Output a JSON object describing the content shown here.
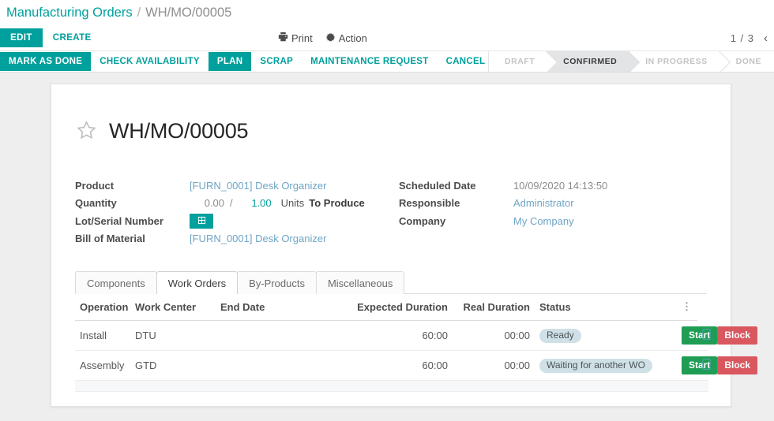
{
  "breadcrumb": {
    "root": "Manufacturing Orders",
    "separator": "/",
    "current": "WH/MO/00005"
  },
  "control_panel": {
    "edit_label": "EDIT",
    "create_label": "CREATE",
    "print_label": "Print",
    "action_label": "Action",
    "pager": "1 / 3",
    "prev_arrow": "‹"
  },
  "workflow_buttons": [
    {
      "label": "MARK AS DONE",
      "primary": true
    },
    {
      "label": "CHECK AVAILABILITY",
      "primary": false
    },
    {
      "label": "PLAN",
      "primary": true
    },
    {
      "label": "SCRAP",
      "primary": false
    },
    {
      "label": "MAINTENANCE REQUEST",
      "primary": false
    },
    {
      "label": "CANCEL",
      "primary": false
    }
  ],
  "statusbar": [
    {
      "label": "DRAFT",
      "active": false
    },
    {
      "label": "CONFIRMED",
      "active": true
    },
    {
      "label": "IN PROGRESS",
      "active": false
    },
    {
      "label": "DONE",
      "active": false
    }
  ],
  "record": {
    "title": "WH/MO/00005",
    "left_fields": {
      "product_label": "Product",
      "product_value": "[FURN_0001] Desk Organizer",
      "quantity_label": "Quantity",
      "quantity_done": "0.00",
      "quantity_slash": "/",
      "quantity_todo": "1.00",
      "quantity_uom": "Units",
      "quantity_suffix": "To Produce",
      "lot_label": "Lot/Serial Number",
      "bom_label": "Bill of Material",
      "bom_value": "[FURN_0001] Desk Organizer"
    },
    "right_fields": {
      "scheduled_label": "Scheduled Date",
      "scheduled_value": "10/09/2020 14:13:50",
      "responsible_label": "Responsible",
      "responsible_value": "Administrator",
      "company_label": "Company",
      "company_value": "My Company"
    }
  },
  "notebook": {
    "tabs": [
      {
        "label": "Components",
        "active": false
      },
      {
        "label": "Work Orders",
        "active": true
      },
      {
        "label": "By-Products",
        "active": false
      },
      {
        "label": "Miscellaneous",
        "active": false
      }
    ]
  },
  "work_orders_table": {
    "columns": [
      "Operation",
      "Work Center",
      "End Date",
      "Expected Duration",
      "Real Duration",
      "Status"
    ],
    "rows": [
      {
        "operation": "Install",
        "work_center": "DTU",
        "end_date": "",
        "expected_duration": "60:00",
        "real_duration": "00:00",
        "status": "Ready",
        "start_label": "Start",
        "block_label": "Block"
      },
      {
        "operation": "Assembly",
        "work_center": "GTD",
        "end_date": "",
        "expected_duration": "60:00",
        "real_duration": "00:00",
        "status": "Waiting for another WO",
        "start_label": "Start",
        "block_label": "Block"
      }
    ]
  },
  "colors": {
    "accent_teal": "#00A09D",
    "start_green": "#1f9d55",
    "block_red": "#d9585f",
    "badge_bg": "#cfe0e6",
    "link_blue": "#6ea5c4"
  }
}
